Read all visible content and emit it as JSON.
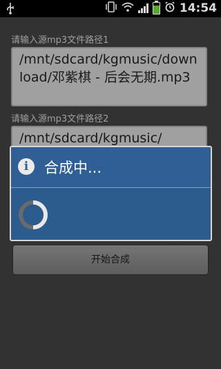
{
  "status_bar": {
    "time": "14:54",
    "icons": [
      "usb-icon",
      "vibrate-icon",
      "wifi-icon",
      "signal-icon",
      "battery-icon",
      "alarm-icon"
    ]
  },
  "form": {
    "source1_label": "请输入源mp3文件路径1",
    "source1_value": "/mnt/sdcard/kgmusic/download/邓紫棋 - 后会无期.mp3",
    "source2_label": "请输入源mp3文件路径2",
    "source2_value": "/mnt/sdcard/kgmusic/",
    "start_button": "开始合成"
  },
  "dialog": {
    "title": "合成中...",
    "icon": "info-icon"
  },
  "colors": {
    "dialog_bg": "#2c5b8e",
    "background": "#3b3b3b",
    "field_bg": "#bdbdbd"
  }
}
